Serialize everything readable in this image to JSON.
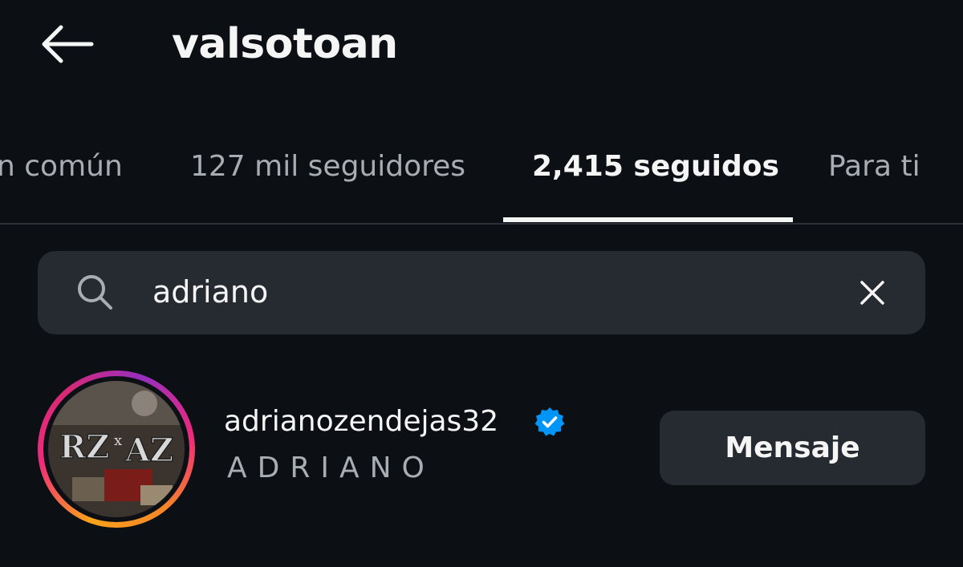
{
  "header": {
    "title": "valsotoan",
    "back_icon": "arrow-left-icon"
  },
  "tabs": [
    {
      "label": "n común",
      "active": false
    },
    {
      "label": "127 mil seguidores",
      "active": false
    },
    {
      "label": "2,415 seguidos",
      "active": true
    },
    {
      "label": "Para ti",
      "active": false
    }
  ],
  "search": {
    "value": "adriano",
    "icon": "search-icon",
    "clear_icon": "close-icon"
  },
  "results": [
    {
      "username": "adrianozendejas32",
      "full_name": "ADRIANO",
      "verified": true,
      "has_story_ring": true,
      "action_label": "Mensaje"
    }
  ],
  "colors": {
    "background": "#0c1014",
    "surface": "#262a31",
    "text_primary": "#f5f5f5",
    "text_secondary": "#a8adb4",
    "verified_badge": "#0095f6"
  }
}
